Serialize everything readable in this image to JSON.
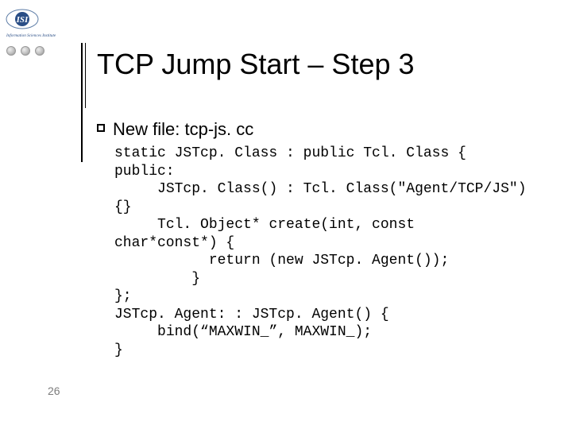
{
  "page_number": "26",
  "title": "TCP Jump Start – Step 3",
  "logo": {
    "text": "ISI",
    "subtitle": "Information Sciences Institute"
  },
  "bullet": {
    "text": "New file: tcp-js. cc"
  },
  "code": "static JSTcp. Class : public Tcl. Class {\npublic:\n     JSTcp. Class() : Tcl. Class(\"Agent/TCP/JS\")\n{}\n     Tcl. Object* create(int, const\nchar*const*) {\n           return (new JSTcp. Agent());\n         }\n};\nJSTcp. Agent: : JSTcp. Agent() {\n     bind(“MAXWIN_”, MAXWIN_);\n}"
}
